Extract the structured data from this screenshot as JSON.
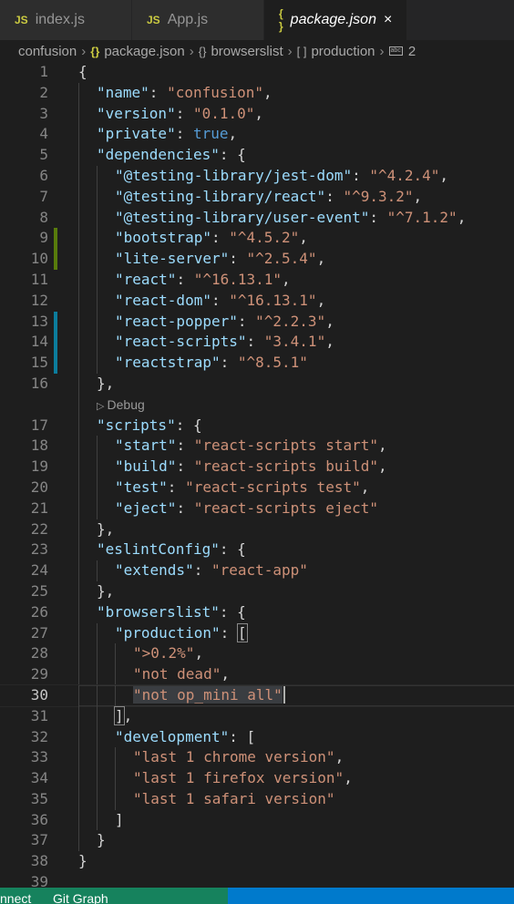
{
  "tabs": [
    {
      "icon": "JS",
      "label": "index.js",
      "active": false
    },
    {
      "icon": "JS",
      "label": "App.js",
      "active": false
    },
    {
      "icon": "{ }",
      "label": "package.json",
      "active": true,
      "close": "×"
    }
  ],
  "breadcrumb": {
    "root": "confusion",
    "file": "package.json",
    "node1": "browserslist",
    "node2": "production",
    "node3": "2"
  },
  "codelens": "Debug",
  "lines": [
    {
      "n": "1",
      "indent": 0,
      "tokens": [
        [
          "p",
          "{"
        ]
      ]
    },
    {
      "n": "2",
      "indent": 1,
      "tokens": [
        [
          "k",
          "\"name\""
        ],
        [
          "p",
          ": "
        ],
        [
          "s",
          "\"confusion\""
        ],
        [
          "p",
          ","
        ]
      ]
    },
    {
      "n": "3",
      "indent": 1,
      "tokens": [
        [
          "k",
          "\"version\""
        ],
        [
          "p",
          ": "
        ],
        [
          "s",
          "\"0.1.0\""
        ],
        [
          "p",
          ","
        ]
      ]
    },
    {
      "n": "4",
      "indent": 1,
      "tokens": [
        [
          "k",
          "\"private\""
        ],
        [
          "p",
          ": "
        ],
        [
          "b",
          "true"
        ],
        [
          "p",
          ","
        ]
      ]
    },
    {
      "n": "5",
      "indent": 1,
      "tokens": [
        [
          "k",
          "\"dependencies\""
        ],
        [
          "p",
          ": {"
        ]
      ]
    },
    {
      "n": "6",
      "indent": 2,
      "tokens": [
        [
          "k",
          "\"@testing-library/jest-dom\""
        ],
        [
          "p",
          ": "
        ],
        [
          "s",
          "\"^4.2.4\""
        ],
        [
          "p",
          ","
        ]
      ]
    },
    {
      "n": "7",
      "indent": 2,
      "tokens": [
        [
          "k",
          "\"@testing-library/react\""
        ],
        [
          "p",
          ": "
        ],
        [
          "s",
          "\"^9.3.2\""
        ],
        [
          "p",
          ","
        ]
      ]
    },
    {
      "n": "8",
      "indent": 2,
      "tokens": [
        [
          "k",
          "\"@testing-library/user-event\""
        ],
        [
          "p",
          ": "
        ],
        [
          "s",
          "\"^7.1.2\""
        ],
        [
          "p",
          ","
        ]
      ]
    },
    {
      "n": "9",
      "indent": 2,
      "gutter": "add",
      "tokens": [
        [
          "k",
          "\"bootstrap\""
        ],
        [
          "p",
          ": "
        ],
        [
          "s",
          "\"^4.5.2\""
        ],
        [
          "p",
          ","
        ]
      ]
    },
    {
      "n": "10",
      "indent": 2,
      "gutter": "add",
      "tokens": [
        [
          "k",
          "\"lite-server\""
        ],
        [
          "p",
          ": "
        ],
        [
          "s",
          "\"^2.5.4\""
        ],
        [
          "p",
          ","
        ]
      ]
    },
    {
      "n": "11",
      "indent": 2,
      "tokens": [
        [
          "k",
          "\"react\""
        ],
        [
          "p",
          ": "
        ],
        [
          "s",
          "\"^16.13.1\""
        ],
        [
          "p",
          ","
        ]
      ]
    },
    {
      "n": "12",
      "indent": 2,
      "tokens": [
        [
          "k",
          "\"react-dom\""
        ],
        [
          "p",
          ": "
        ],
        [
          "s",
          "\"^16.13.1\""
        ],
        [
          "p",
          ","
        ]
      ]
    },
    {
      "n": "13",
      "indent": 2,
      "gutter": "mod",
      "tokens": [
        [
          "k",
          "\"react-popper\""
        ],
        [
          "p",
          ": "
        ],
        [
          "s",
          "\"^2.2.3\""
        ],
        [
          "p",
          ","
        ]
      ]
    },
    {
      "n": "14",
      "indent": 2,
      "gutter": "mod",
      "tokens": [
        [
          "k",
          "\"react-scripts\""
        ],
        [
          "p",
          ": "
        ],
        [
          "s",
          "\"3.4.1\""
        ],
        [
          "p",
          ","
        ]
      ]
    },
    {
      "n": "15",
      "indent": 2,
      "gutter": "mod",
      "tokens": [
        [
          "k",
          "\"reactstrap\""
        ],
        [
          "p",
          ": "
        ],
        [
          "s",
          "\"^8.5.1\""
        ]
      ]
    },
    {
      "n": "16",
      "indent": 1,
      "tokens": [
        [
          "p",
          "},"
        ]
      ]
    },
    {
      "n": "",
      "codelens": true,
      "tokens": []
    },
    {
      "n": "17",
      "indent": 1,
      "tokens": [
        [
          "k",
          "\"scripts\""
        ],
        [
          "p",
          ": {"
        ]
      ]
    },
    {
      "n": "18",
      "indent": 2,
      "tokens": [
        [
          "k",
          "\"start\""
        ],
        [
          "p",
          ": "
        ],
        [
          "s",
          "\"react-scripts start\""
        ],
        [
          "p",
          ","
        ]
      ]
    },
    {
      "n": "19",
      "indent": 2,
      "tokens": [
        [
          "k",
          "\"build\""
        ],
        [
          "p",
          ": "
        ],
        [
          "s",
          "\"react-scripts build\""
        ],
        [
          "p",
          ","
        ]
      ]
    },
    {
      "n": "20",
      "indent": 2,
      "tokens": [
        [
          "k",
          "\"test\""
        ],
        [
          "p",
          ": "
        ],
        [
          "s",
          "\"react-scripts test\""
        ],
        [
          "p",
          ","
        ]
      ]
    },
    {
      "n": "21",
      "indent": 2,
      "tokens": [
        [
          "k",
          "\"eject\""
        ],
        [
          "p",
          ": "
        ],
        [
          "s",
          "\"react-scripts eject\""
        ]
      ]
    },
    {
      "n": "22",
      "indent": 1,
      "tokens": [
        [
          "p",
          "},"
        ]
      ]
    },
    {
      "n": "23",
      "indent": 1,
      "tokens": [
        [
          "k",
          "\"eslintConfig\""
        ],
        [
          "p",
          ": {"
        ]
      ]
    },
    {
      "n": "24",
      "indent": 2,
      "tokens": [
        [
          "k",
          "\"extends\""
        ],
        [
          "p",
          ": "
        ],
        [
          "s",
          "\"react-app\""
        ]
      ]
    },
    {
      "n": "25",
      "indent": 1,
      "tokens": [
        [
          "p",
          "},"
        ]
      ]
    },
    {
      "n": "26",
      "indent": 1,
      "tokens": [
        [
          "k",
          "\"browserslist\""
        ],
        [
          "p",
          ": {"
        ]
      ]
    },
    {
      "n": "27",
      "indent": 2,
      "tokens": [
        [
          "k",
          "\"production\""
        ],
        [
          "p",
          ": "
        ],
        [
          "brk",
          "["
        ]
      ]
    },
    {
      "n": "28",
      "indent": 3,
      "tokens": [
        [
          "s",
          "\">0.2%\""
        ],
        [
          "p",
          ","
        ]
      ]
    },
    {
      "n": "29",
      "indent": 3,
      "tokens": [
        [
          "s",
          "\"not dead\""
        ],
        [
          "p",
          ","
        ]
      ]
    },
    {
      "n": "30",
      "indent": 3,
      "current": true,
      "tokens": [
        [
          "sel",
          "\"not op_mini all\""
        ]
      ]
    },
    {
      "n": "31",
      "indent": 2,
      "tokens": [
        [
          "brk",
          "]"
        ],
        [
          "p",
          ","
        ]
      ]
    },
    {
      "n": "32",
      "indent": 2,
      "tokens": [
        [
          "k",
          "\"development\""
        ],
        [
          "p",
          ": ["
        ]
      ]
    },
    {
      "n": "33",
      "indent": 3,
      "tokens": [
        [
          "s",
          "\"last 1 chrome version\""
        ],
        [
          "p",
          ","
        ]
      ]
    },
    {
      "n": "34",
      "indent": 3,
      "tokens": [
        [
          "s",
          "\"last 1 firefox version\""
        ],
        [
          "p",
          ","
        ]
      ]
    },
    {
      "n": "35",
      "indent": 3,
      "tokens": [
        [
          "s",
          "\"last 1 safari version\""
        ]
      ]
    },
    {
      "n": "36",
      "indent": 2,
      "tokens": [
        [
          "p",
          "]"
        ]
      ]
    },
    {
      "n": "37",
      "indent": 1,
      "tokens": [
        [
          "p",
          "}"
        ]
      ]
    },
    {
      "n": "38",
      "indent": 0,
      "tokens": [
        [
          "p",
          "}"
        ]
      ]
    },
    {
      "n": "39",
      "indent": 0,
      "tokens": []
    }
  ],
  "statusbar": {
    "left_item": "nnect",
    "git_graph": "Git Graph"
  },
  "colors": {
    "key": "#9cdcfe",
    "string": "#ce9178",
    "keyword": "#569cd6",
    "added": "#587c0c",
    "modified": "#0c7d9d",
    "statusbar": "#007acc"
  }
}
